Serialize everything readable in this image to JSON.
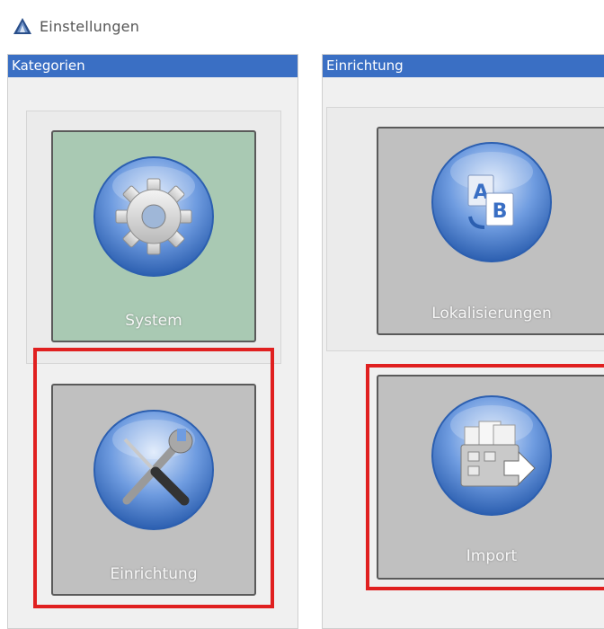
{
  "window": {
    "title": "Einstellungen"
  },
  "colors": {
    "header": "#3a6fc4",
    "selected_tile": "#a9c9b3",
    "tile": "#c0c0c0",
    "highlight": "#e02020"
  },
  "left_panel": {
    "header": "Kategorien",
    "tiles": [
      {
        "label": "System",
        "icon": "gear-icon",
        "selected": true
      },
      {
        "label": "Einrichtung",
        "icon": "tools-icon",
        "selected": false,
        "highlighted": true
      }
    ]
  },
  "right_panel": {
    "header": "Einrichtung",
    "tiles": [
      {
        "label": "Lokalisierungen",
        "icon": "localization-icon",
        "selected": false
      },
      {
        "label": "Import",
        "icon": "import-icon",
        "selected": false,
        "highlighted": true
      }
    ]
  }
}
